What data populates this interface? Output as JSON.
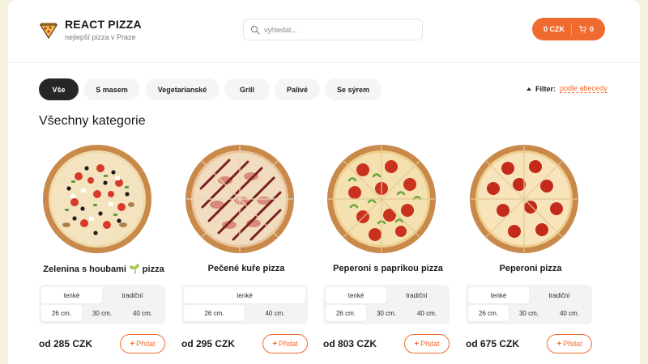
{
  "app": {
    "title": "REACT PIZZA",
    "subtitle": "nejlepší pizza v Praze",
    "brand_color": "#f06b2f"
  },
  "search": {
    "placeholder": "vyhledat..."
  },
  "cart": {
    "total": "0 CZK",
    "count": "0"
  },
  "categories": [
    {
      "label": "Vše",
      "active": true
    },
    {
      "label": "S masem",
      "active": false
    },
    {
      "label": "Vegetarianské",
      "active": false
    },
    {
      "label": "Grill",
      "active": false
    },
    {
      "label": "Palivé",
      "active": false
    },
    {
      "label": "Se sýrem",
      "active": false
    }
  ],
  "sort": {
    "label": "Filter:",
    "value": "podle abecedy"
  },
  "section_title": "Všechny kategorie",
  "pizzas": [
    {
      "name": "Zelenina s houbami 🌱 pizza",
      "types": [
        "tenké",
        "tradiční"
      ],
      "active_type": "tenké",
      "sizes": [
        "26 cm.",
        "30 cm.",
        "40 cm."
      ],
      "active_size": "26 cm.",
      "price": "od 285 CZK",
      "add_label": "Přidat",
      "image": "veggie-pizza"
    },
    {
      "name": "Pečené kuře pizza",
      "types": [
        "tenké"
      ],
      "active_type": "tenké",
      "sizes": [
        "26 cm.",
        "40 cm."
      ],
      "active_size": "26 cm.",
      "price": "od 295 CZK",
      "add_label": "Přidat",
      "image": "bbq-chicken-pizza"
    },
    {
      "name": "Peperoni s paprikou pizza",
      "types": [
        "tenké",
        "tradiční"
      ],
      "active_type": "tenké",
      "sizes": [
        "26 cm.",
        "30 cm.",
        "40 cm."
      ],
      "active_size": "26 cm.",
      "price": "od 803 CZK",
      "add_label": "Přidat",
      "image": "pepperoni-pepper-pizza"
    },
    {
      "name": "Peperoni pizza",
      "types": [
        "tenké",
        "tradiční"
      ],
      "active_type": "tenké",
      "sizes": [
        "26 cm.",
        "30 cm.",
        "40 cm."
      ],
      "active_size": "26 cm.",
      "price": "od 675 CZK",
      "add_label": "Přidat",
      "image": "pepperoni-pizza"
    }
  ]
}
